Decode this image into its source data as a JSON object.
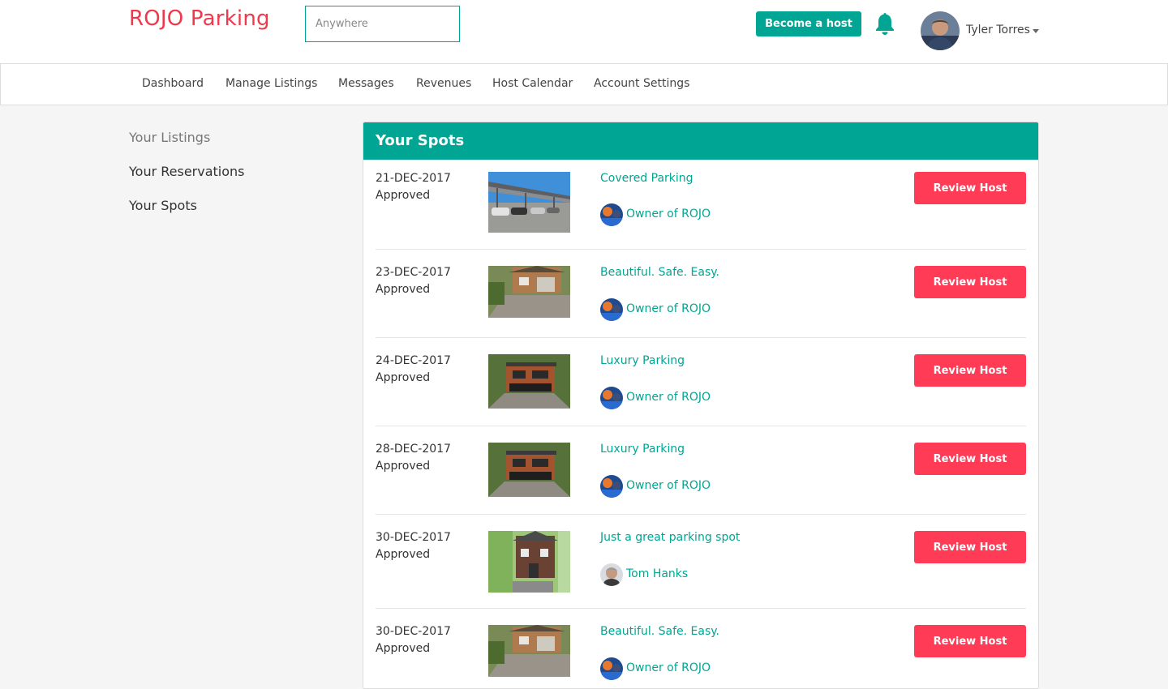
{
  "header": {
    "logo": "ROJO Parking",
    "search_placeholder": "Anywhere",
    "become_host": "Become a host",
    "user_name": "Tyler Torres",
    "accent": "#00a693",
    "brand": "#f0384c"
  },
  "nav": {
    "items": [
      "Dashboard",
      "Manage Listings",
      "Messages",
      "Revenues",
      "Host Calendar",
      "Account Settings"
    ]
  },
  "sidebar": {
    "items": [
      "Your Listings",
      "Your Reservations",
      "Your Spots"
    ]
  },
  "panel": {
    "title": "Your Spots",
    "review_label": "Review Host",
    "rows": [
      {
        "date": "21-DEC-2017",
        "status": "Approved",
        "title": "Covered Parking",
        "host": "Owner of ROJO"
      },
      {
        "date": "23-DEC-2017",
        "status": "Approved",
        "title": "Beautiful. Safe. Easy.",
        "host": "Owner of ROJO"
      },
      {
        "date": "24-DEC-2017",
        "status": "Approved",
        "title": "Luxury Parking",
        "host": "Owner of ROJO"
      },
      {
        "date": "28-DEC-2017",
        "status": "Approved",
        "title": "Luxury Parking",
        "host": "Owner of ROJO"
      },
      {
        "date": "30-DEC-2017",
        "status": "Approved",
        "title": "Just a great parking spot",
        "host": "Tom Hanks"
      },
      {
        "date": "30-DEC-2017",
        "status": "Approved",
        "title": "Beautiful. Safe. Easy.",
        "host": "Owner of ROJO"
      }
    ]
  }
}
